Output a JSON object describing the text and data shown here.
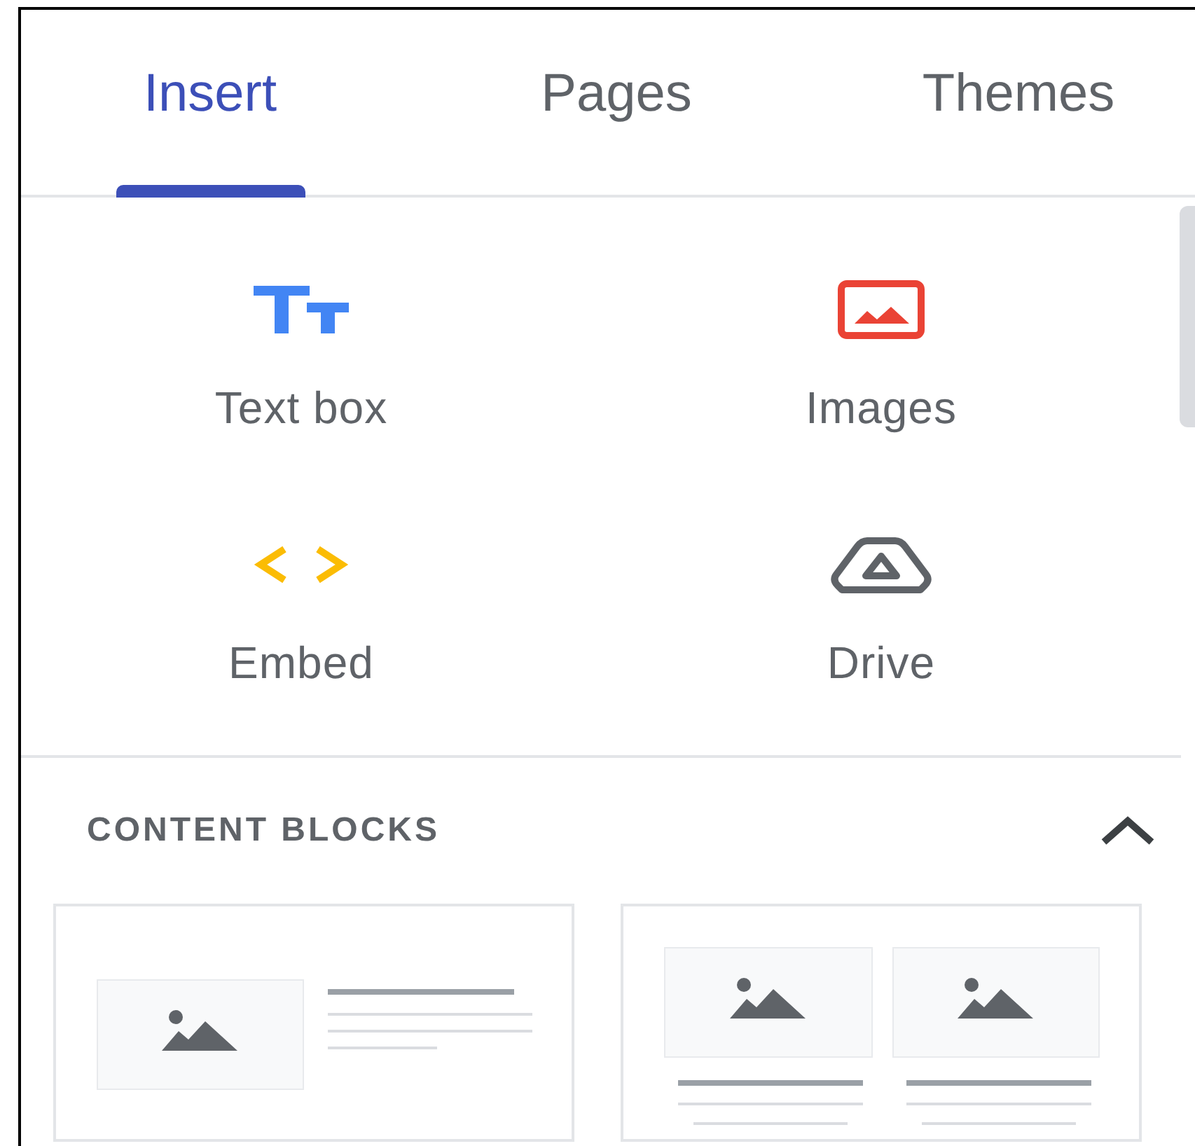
{
  "tabs": [
    {
      "label": "Insert",
      "selected": true
    },
    {
      "label": "Pages",
      "selected": false
    },
    {
      "label": "Themes",
      "selected": false
    }
  ],
  "tools": [
    {
      "kind": "text",
      "label": "Text box"
    },
    {
      "kind": "image",
      "label": "Images"
    },
    {
      "kind": "embed",
      "label": "Embed"
    },
    {
      "kind": "drive",
      "label": "Drive"
    }
  ],
  "content_blocks": {
    "title": "CONTENT BLOCKS",
    "expanded": true,
    "blocks": [
      {
        "kind": "image-text"
      },
      {
        "kind": "two-images"
      }
    ]
  }
}
